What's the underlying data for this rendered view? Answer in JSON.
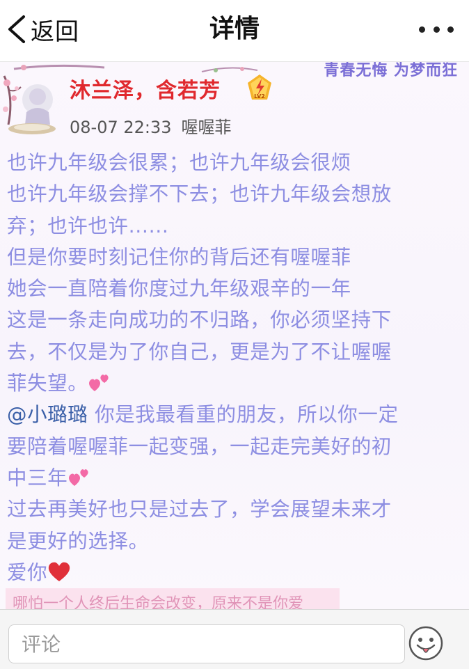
{
  "nav": {
    "back_label": "返回",
    "title": "详情",
    "more_icon": "more-dots-icon"
  },
  "post": {
    "slogan": "青春无悔 为梦而狂",
    "username": "沐兰泽，含若芳",
    "level": "LV2",
    "timestamp": "08-07 22:33",
    "author": "喔喔菲",
    "lines": [
      "也许九年级会很累；也许九年级会很烦",
      "也许九年级会撑不下去；也许九年级会想放",
      "弃；也许也许......",
      "但是你要时刻记住你的背后还有喔喔菲",
      "她会一直陪着你度过九年级艰辛的一年",
      "这是一条走向成功的不归路，你必须坚持下",
      "去，不仅是为了你自己，更是为了不让喔喔",
      "菲失望。"
    ],
    "mention": "@小璐璐",
    "mention_text": " 你是我最看重的朋友，所以你一定",
    "lines2": [
      "要陪着喔喔菲一起变强，一起走完美好的初",
      "中三年"
    ],
    "lines3": [
      "过去再美好也只是过去了，学会展望未来才",
      "是更好的选择。"
    ],
    "closing": "爱你",
    "faded_strip": "哪怕一个人终后生命会改变，原来不是你爱"
  },
  "comment": {
    "placeholder": "评论",
    "emoji_icon": "emoji-face-icon"
  },
  "colors": {
    "username": "#e0282d",
    "content": "#8d8ee2",
    "mention": "#3a5fa8",
    "heart": "#e0303a"
  }
}
